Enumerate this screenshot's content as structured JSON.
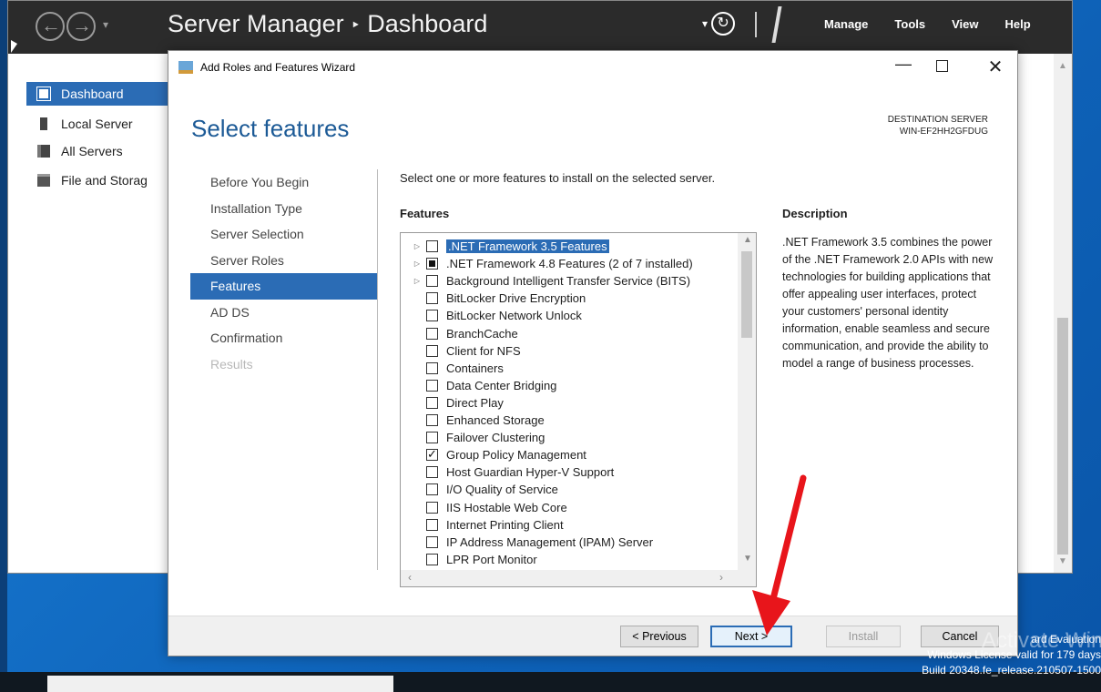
{
  "server_manager": {
    "nav_back": "←",
    "nav_forward": "→",
    "nav_dropdown": "▾",
    "breadcrumb_app": "Server Manager",
    "breadcrumb_separator": "‣",
    "breadcrumb_page": "Dashboard",
    "refresh_dropdown": "▾",
    "refresh_icon": "↻",
    "menu": [
      "Manage",
      "Tools",
      "View",
      "Help"
    ],
    "sidebar": [
      {
        "label": "Dashboard",
        "icon": "dashboard-grid-icon",
        "active": true
      },
      {
        "label": "Local Server",
        "icon": "server-icon",
        "active": false
      },
      {
        "label": "All Servers",
        "icon": "servers-icon",
        "active": false
      },
      {
        "label": "File and Storag",
        "icon": "file-storage-icon",
        "active": false
      }
    ]
  },
  "wizard": {
    "title": "Add Roles and Features Wizard",
    "heading": "Select features",
    "destination_label": "DESTINATION SERVER",
    "destination_value": "WIN-EF2HH2GFDUG",
    "steps": [
      {
        "label": "Before You Begin",
        "state": "normal"
      },
      {
        "label": "Installation Type",
        "state": "normal"
      },
      {
        "label": "Server Selection",
        "state": "normal"
      },
      {
        "label": "Server Roles",
        "state": "normal"
      },
      {
        "label": "Features",
        "state": "active"
      },
      {
        "label": "AD DS",
        "state": "normal"
      },
      {
        "label": "Confirmation",
        "state": "normal"
      },
      {
        "label": "Results",
        "state": "disabled"
      }
    ],
    "instruction": "Select one or more features to install on the selected server.",
    "features_label": "Features",
    "description_label": "Description",
    "description_text": ".NET Framework 3.5 combines the power of the .NET Framework 2.0 APIs with new technologies for building applications that offer appealing user interfaces, protect your customers' personal identity information, enable seamless and secure communication, and provide the ability to model a range of business processes.",
    "features": [
      {
        "label": ".NET Framework 3.5 Features",
        "expandable": true,
        "state": "unchecked",
        "selected": true
      },
      {
        "label": ".NET Framework 4.8 Features (2 of 7 installed)",
        "expandable": true,
        "state": "partial",
        "selected": false
      },
      {
        "label": "Background Intelligent Transfer Service (BITS)",
        "expandable": true,
        "state": "unchecked",
        "selected": false
      },
      {
        "label": "BitLocker Drive Encryption",
        "expandable": false,
        "state": "unchecked",
        "selected": false
      },
      {
        "label": "BitLocker Network Unlock",
        "expandable": false,
        "state": "unchecked",
        "selected": false
      },
      {
        "label": "BranchCache",
        "expandable": false,
        "state": "unchecked",
        "selected": false
      },
      {
        "label": "Client for NFS",
        "expandable": false,
        "state": "unchecked",
        "selected": false
      },
      {
        "label": "Containers",
        "expandable": false,
        "state": "unchecked",
        "selected": false
      },
      {
        "label": "Data Center Bridging",
        "expandable": false,
        "state": "unchecked",
        "selected": false
      },
      {
        "label": "Direct Play",
        "expandable": false,
        "state": "unchecked",
        "selected": false
      },
      {
        "label": "Enhanced Storage",
        "expandable": false,
        "state": "unchecked",
        "selected": false
      },
      {
        "label": "Failover Clustering",
        "expandable": false,
        "state": "unchecked",
        "selected": false
      },
      {
        "label": "Group Policy Management",
        "expandable": false,
        "state": "checked",
        "selected": false
      },
      {
        "label": "Host Guardian Hyper-V Support",
        "expandable": false,
        "state": "unchecked",
        "selected": false
      },
      {
        "label": "I/O Quality of Service",
        "expandable": false,
        "state": "unchecked",
        "selected": false
      },
      {
        "label": "IIS Hostable Web Core",
        "expandable": false,
        "state": "unchecked",
        "selected": false
      },
      {
        "label": "Internet Printing Client",
        "expandable": false,
        "state": "unchecked",
        "selected": false
      },
      {
        "label": "IP Address Management (IPAM) Server",
        "expandable": false,
        "state": "unchecked",
        "selected": false
      },
      {
        "label": "LPR Port Monitor",
        "expandable": false,
        "state": "unchecked",
        "selected": false
      }
    ],
    "buttons": {
      "previous": "< Previous",
      "next": "Next >",
      "install": "Install",
      "cancel": "Cancel"
    }
  },
  "watermark": {
    "line1": "ard Evaluation",
    "line2": "Windows License valid for 179 days",
    "line3": "Build 20348.fe_release.210507-1500",
    "activate": "Activate Win"
  },
  "colors": {
    "accent": "#2b6cb5",
    "annotation_arrow": "#e8151b"
  }
}
